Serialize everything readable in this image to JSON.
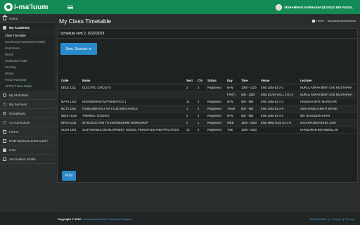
{
  "header": {
    "brand": "i-ma'luum",
    "user_name": "MUHAMMAD NURHAKIM QUDDUS BIN FAIZUL"
  },
  "sidebar": {
    "items": [
      {
        "label": "Home",
        "icon": "home-icon"
      },
      {
        "label": "My Academic",
        "icon": "academic-icon"
      },
      {
        "label": "My MohdSah",
        "icon": "circle-icon"
      },
      {
        "label": "My Services",
        "icon": "gear-icon"
      },
      {
        "label": "Disciplinary",
        "icon": "circle-icon"
      },
      {
        "label": "Co-Curriculum",
        "icon": "gear-icon"
      },
      {
        "label": "Forms",
        "icon": "doc-icon"
      },
      {
        "label": "RHB MySiswa-Iiu/IIt Card-i",
        "icon": "doc-icon"
      },
      {
        "label": "HOA",
        "icon": "people-icon"
      },
      {
        "label": "Vaccination Profile",
        "icon": "doc-icon"
      }
    ],
    "academic_sub": [
      "Class Timetable",
      "Continuous Assessment Marks",
      "Final Exam",
      "Result",
      "Graduation Audit",
      "Pre-Reg",
      "Others",
      "Portal Transcript",
      "APTEPT New Intake"
    ]
  },
  "main": {
    "title": "My Class Timetable",
    "breadcrumb": [
      "Home",
      "MyAcademic/schedule"
    ],
    "panel_title": "Schedule sem 2, 2022/2023",
    "session_button": "Sem, Session",
    "print_button": "Print"
  },
  "table": {
    "headers": [
      "Code",
      "Name",
      "Sect",
      "Chr",
      "Status",
      "Day",
      "Time",
      "Venue",
      "Lecturer"
    ],
    "rows": [
      {
        "code": "EECE 1311",
        "name": "ELECTRIC CIRCUITS",
        "sect": "3",
        "chr": "3",
        "status": "Registered",
        "day": "M-W",
        "time": "1000 - 1120",
        "venue": "ENG LBM E2-2-3",
        "lecturer": "NURUL ARFAH BINTI CHE MUSTAPHA"
      },
      {
        "code": "",
        "name": "",
        "sect": "",
        "chr": "",
        "status": "",
        "day": "FRI(T)",
        "time": "800 - 1030",
        "venue": "ENG EXAM HALL 3 E3-4",
        "lecturer": "NURUL ARFAH BINTI CHE MUSTAPHA"
      },
      {
        "code": "MATH 1310",
        "name": "ENGINEERING MATHEMATICS 1",
        "sect": "11",
        "chr": "3",
        "status": "Registered",
        "day": "M-W",
        "time": "830 - 950",
        "venue": "ENG LBM E1-1-4",
        "lecturer": "HANISAH BINTI MANSHOR"
      },
      {
        "code": "MCTA 1201",
        "name": "FUNDAMENTALS OF FLUID MECHANICS",
        "sect": "1",
        "chr": "2",
        "status": "Registered",
        "day": "THUR",
        "time": "800 - 950",
        "venue": "ENG LBM E1-3-9",
        "lecturer": "AZNI NABELA BINTI WAHID"
      },
      {
        "code": "MECH 1340",
        "name": "THERMAL SCIENCE",
        "sect": "2",
        "chr": "3",
        "status": "Registered",
        "day": "M-W",
        "time": "830 - 950",
        "venue": "ENG LBM E1-3-3",
        "lecturer": "MD. BASUDDIN KHAN"
      },
      {
        "code": "MFGA 1141",
        "name": "INTRODUCTION TO ENGINEERING WORKSHOP",
        "sect": "2",
        "chr": "1",
        "status": "Registered",
        "day": "WED",
        "time": "1400 - 1650",
        "venue": "ENG MINI AUDI E1-1-8",
        "lecturer": "ZAKARIA BIN MOHD. ZAIN"
      },
      {
        "code": "SCSH 1201",
        "name": "SUSTAINABLE DEVELOPMENT: ISSUES, PRINCIPLES AND PRACTICES",
        "sect": "10",
        "chr": "2",
        "status": "Registered",
        "day": "TUE",
        "time": "1000 - 1200",
        "venue": "",
        "lecturer": "KHAIZURAN BIN ABDULLAH"
      }
    ]
  },
  "footer": {
    "copyright": "Copyright © 2016",
    "org": "International Islamic University Malaysia",
    "links": [
      "IIUM Website",
      "i-Cvtoom",
      "Pre-reg"
    ]
  }
}
